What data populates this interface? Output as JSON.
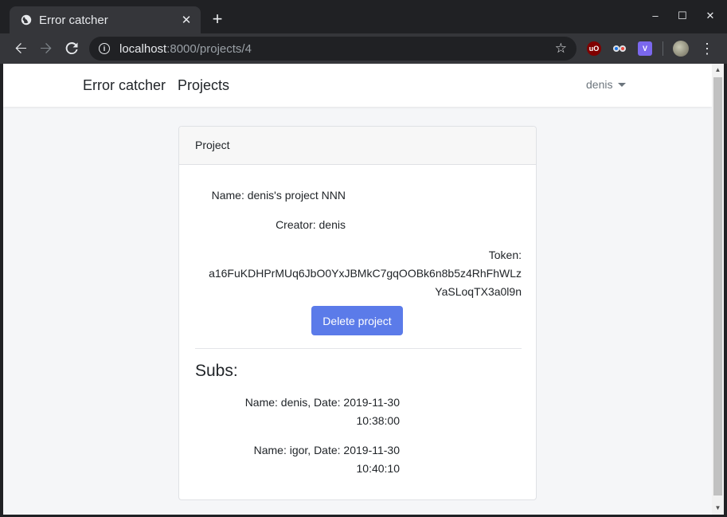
{
  "browser": {
    "tab_title": "Error catcher",
    "url_host": "localhost",
    "url_path": ":8000/projects/4",
    "new_tab": "+",
    "close_tab": "✕",
    "window_controls": {
      "minimize": "–",
      "maximize": "☐",
      "close": "✕"
    },
    "extensions": [
      {
        "name": "ublock-origin-icon",
        "label": "uO",
        "color": "#800000"
      },
      {
        "name": "eyes-extension-icon",
        "label": "👀",
        "color": "#35363a"
      },
      {
        "name": "v-extension-icon",
        "label": "V",
        "color": "#7b68ee"
      }
    ]
  },
  "navbar": {
    "brand": "Error catcher",
    "projects_link": "Projects",
    "user": "denis"
  },
  "card": {
    "header": "Project",
    "name_line": "Name: denis's project NNN",
    "creator_line": "Creator: denis",
    "token_label": "Token:",
    "token_part1": "a16FuKDHPrMUq6JbO0YxJBMkC7gqOOBk6n8b5z4RhFhWLz",
    "token_part2": "YaSLoqTX3a0l9n",
    "delete_button": "Delete project",
    "subs_title": "Subs:",
    "subs": [
      {
        "line1": "Name: denis, Date: 2019-11-30",
        "line2": "10:38:00"
      },
      {
        "line1": "Name: igor, Date: 2019-11-30",
        "line2": "10:40:10"
      }
    ]
  }
}
